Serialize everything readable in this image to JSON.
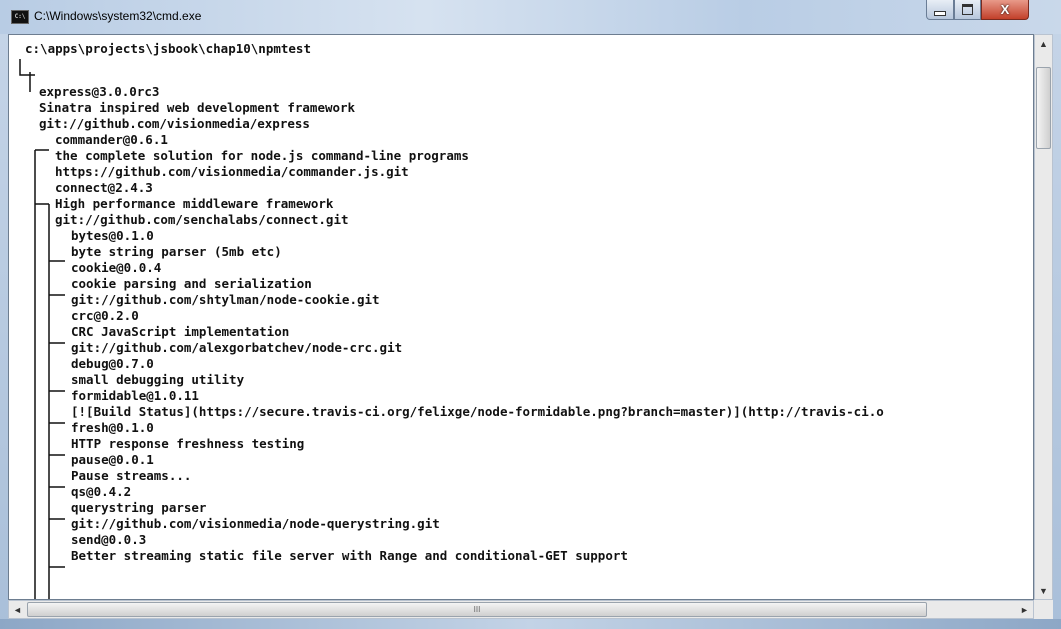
{
  "window": {
    "title": "C:\\Windows\\system32\\cmd.exe",
    "app_icon_label": "C:\\",
    "controls": {
      "minimize": "–",
      "maximize": "□",
      "close": "X"
    }
  },
  "console": {
    "prompt_path": "c:\\apps\\projects\\jsbook\\chap10\\npmtest",
    "lines": [
      "express@3.0.0rc3",
      "Sinatra inspired web development framework",
      "git://github.com/visionmedia/express",
      "commander@0.6.1",
      "the complete solution for node.js command-line programs",
      "https://github.com/visionmedia/commander.js.git",
      "connect@2.4.3",
      "High performance middleware framework",
      "git://github.com/senchalabs/connect.git",
      "bytes@0.1.0",
      "byte string parser (5mb etc)",
      "cookie@0.0.4",
      "cookie parsing and serialization",
      "git://github.com/shtylman/node-cookie.git",
      "crc@0.2.0",
      "CRC JavaScript implementation",
      "git://github.com/alexgorbatchev/node-crc.git",
      "debug@0.7.0",
      "small debugging utility",
      "formidable@1.0.11",
      "[![Build Status](https://secure.travis-ci.org/felixge/node-formidable.png?branch=master)](http://travis-ci.o",
      "fresh@0.1.0",
      "HTTP response freshness testing",
      "pause@0.0.1",
      "Pause streams...",
      "qs@0.4.2",
      "querystring parser",
      "git://github.com/visionmedia/node-querystring.git",
      "send@0.0.3",
      "Better streaming static file server with Range and conditional-GET support"
    ]
  },
  "scrollbars": {
    "up_arrow": "▲",
    "down_arrow": "▼",
    "left_arrow": "◄",
    "right_arrow": "►",
    "h_thumb_grip": "III"
  }
}
